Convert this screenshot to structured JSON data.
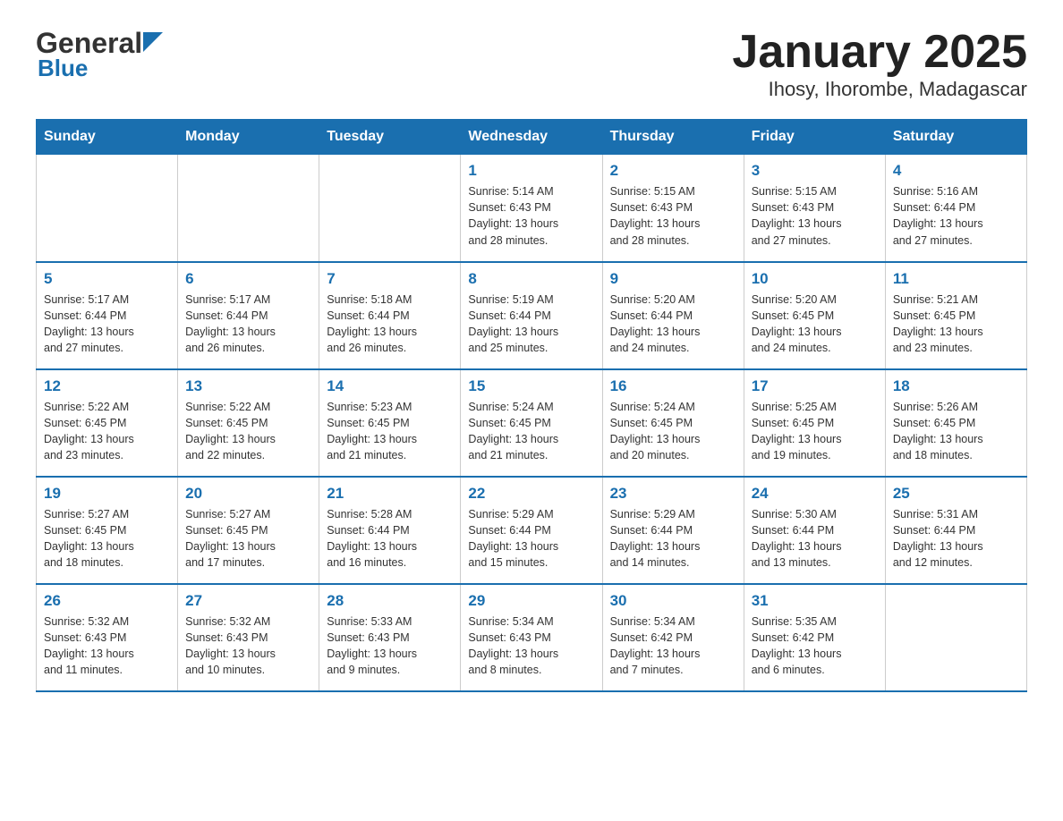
{
  "header": {
    "logo_general": "General",
    "logo_blue": "Blue",
    "title": "January 2025",
    "subtitle": "Ihosy, Ihorombe, Madagascar"
  },
  "days_of_week": [
    "Sunday",
    "Monday",
    "Tuesday",
    "Wednesday",
    "Thursday",
    "Friday",
    "Saturday"
  ],
  "weeks": [
    [
      {
        "day": "",
        "info": ""
      },
      {
        "day": "",
        "info": ""
      },
      {
        "day": "",
        "info": ""
      },
      {
        "day": "1",
        "info": "Sunrise: 5:14 AM\nSunset: 6:43 PM\nDaylight: 13 hours\nand 28 minutes."
      },
      {
        "day": "2",
        "info": "Sunrise: 5:15 AM\nSunset: 6:43 PM\nDaylight: 13 hours\nand 28 minutes."
      },
      {
        "day": "3",
        "info": "Sunrise: 5:15 AM\nSunset: 6:43 PM\nDaylight: 13 hours\nand 27 minutes."
      },
      {
        "day": "4",
        "info": "Sunrise: 5:16 AM\nSunset: 6:44 PM\nDaylight: 13 hours\nand 27 minutes."
      }
    ],
    [
      {
        "day": "5",
        "info": "Sunrise: 5:17 AM\nSunset: 6:44 PM\nDaylight: 13 hours\nand 27 minutes."
      },
      {
        "day": "6",
        "info": "Sunrise: 5:17 AM\nSunset: 6:44 PM\nDaylight: 13 hours\nand 26 minutes."
      },
      {
        "day": "7",
        "info": "Sunrise: 5:18 AM\nSunset: 6:44 PM\nDaylight: 13 hours\nand 26 minutes."
      },
      {
        "day": "8",
        "info": "Sunrise: 5:19 AM\nSunset: 6:44 PM\nDaylight: 13 hours\nand 25 minutes."
      },
      {
        "day": "9",
        "info": "Sunrise: 5:20 AM\nSunset: 6:44 PM\nDaylight: 13 hours\nand 24 minutes."
      },
      {
        "day": "10",
        "info": "Sunrise: 5:20 AM\nSunset: 6:45 PM\nDaylight: 13 hours\nand 24 minutes."
      },
      {
        "day": "11",
        "info": "Sunrise: 5:21 AM\nSunset: 6:45 PM\nDaylight: 13 hours\nand 23 minutes."
      }
    ],
    [
      {
        "day": "12",
        "info": "Sunrise: 5:22 AM\nSunset: 6:45 PM\nDaylight: 13 hours\nand 23 minutes."
      },
      {
        "day": "13",
        "info": "Sunrise: 5:22 AM\nSunset: 6:45 PM\nDaylight: 13 hours\nand 22 minutes."
      },
      {
        "day": "14",
        "info": "Sunrise: 5:23 AM\nSunset: 6:45 PM\nDaylight: 13 hours\nand 21 minutes."
      },
      {
        "day": "15",
        "info": "Sunrise: 5:24 AM\nSunset: 6:45 PM\nDaylight: 13 hours\nand 21 minutes."
      },
      {
        "day": "16",
        "info": "Sunrise: 5:24 AM\nSunset: 6:45 PM\nDaylight: 13 hours\nand 20 minutes."
      },
      {
        "day": "17",
        "info": "Sunrise: 5:25 AM\nSunset: 6:45 PM\nDaylight: 13 hours\nand 19 minutes."
      },
      {
        "day": "18",
        "info": "Sunrise: 5:26 AM\nSunset: 6:45 PM\nDaylight: 13 hours\nand 18 minutes."
      }
    ],
    [
      {
        "day": "19",
        "info": "Sunrise: 5:27 AM\nSunset: 6:45 PM\nDaylight: 13 hours\nand 18 minutes."
      },
      {
        "day": "20",
        "info": "Sunrise: 5:27 AM\nSunset: 6:45 PM\nDaylight: 13 hours\nand 17 minutes."
      },
      {
        "day": "21",
        "info": "Sunrise: 5:28 AM\nSunset: 6:44 PM\nDaylight: 13 hours\nand 16 minutes."
      },
      {
        "day": "22",
        "info": "Sunrise: 5:29 AM\nSunset: 6:44 PM\nDaylight: 13 hours\nand 15 minutes."
      },
      {
        "day": "23",
        "info": "Sunrise: 5:29 AM\nSunset: 6:44 PM\nDaylight: 13 hours\nand 14 minutes."
      },
      {
        "day": "24",
        "info": "Sunrise: 5:30 AM\nSunset: 6:44 PM\nDaylight: 13 hours\nand 13 minutes."
      },
      {
        "day": "25",
        "info": "Sunrise: 5:31 AM\nSunset: 6:44 PM\nDaylight: 13 hours\nand 12 minutes."
      }
    ],
    [
      {
        "day": "26",
        "info": "Sunrise: 5:32 AM\nSunset: 6:43 PM\nDaylight: 13 hours\nand 11 minutes."
      },
      {
        "day": "27",
        "info": "Sunrise: 5:32 AM\nSunset: 6:43 PM\nDaylight: 13 hours\nand 10 minutes."
      },
      {
        "day": "28",
        "info": "Sunrise: 5:33 AM\nSunset: 6:43 PM\nDaylight: 13 hours\nand 9 minutes."
      },
      {
        "day": "29",
        "info": "Sunrise: 5:34 AM\nSunset: 6:43 PM\nDaylight: 13 hours\nand 8 minutes."
      },
      {
        "day": "30",
        "info": "Sunrise: 5:34 AM\nSunset: 6:42 PM\nDaylight: 13 hours\nand 7 minutes."
      },
      {
        "day": "31",
        "info": "Sunrise: 5:35 AM\nSunset: 6:42 PM\nDaylight: 13 hours\nand 6 minutes."
      },
      {
        "day": "",
        "info": ""
      }
    ]
  ]
}
